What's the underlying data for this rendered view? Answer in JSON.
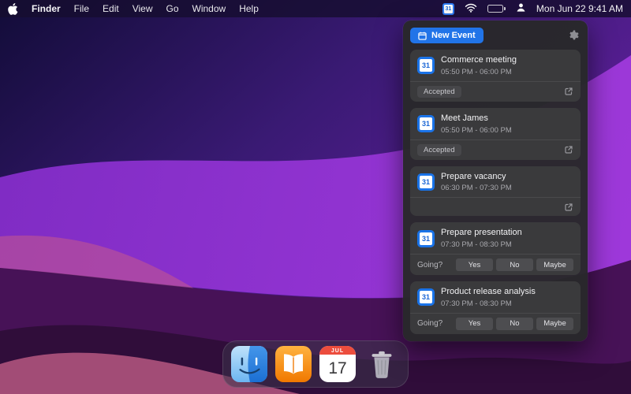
{
  "menubar": {
    "app_name": "Finder",
    "menus": [
      "File",
      "Edit",
      "View",
      "Go",
      "Window",
      "Help"
    ],
    "clock": "Mon Jun 22  9:41 AM",
    "status_icon_number": "31"
  },
  "panel": {
    "new_event": "New Event",
    "icon_number": "31",
    "going_label": "Going?",
    "rsvp": [
      "Yes",
      "No",
      "Maybe"
    ],
    "events": [
      {
        "title": "Commerce meeting",
        "time": "05:50 PM - 06:00 PM",
        "status": "Accepted"
      },
      {
        "title": "Meet James",
        "time": "05:50 PM - 06:00 PM",
        "status": "Accepted"
      },
      {
        "title": "Prepare vacancy",
        "time": "06:30 PM - 07:30 PM",
        "status": ""
      },
      {
        "title": "Prepare presentation",
        "time": "07:30 PM - 08:30 PM",
        "status": "Going?"
      },
      {
        "title": "Product release analysis",
        "time": "07:30 PM - 08:30 PM",
        "status": "Going?"
      }
    ]
  },
  "dock": {
    "calendar_month": "JUL",
    "calendar_day": "17"
  },
  "colors": {
    "accent_blue": "#2174e8",
    "panel_bg": "#28282a",
    "card_bg": "#3a3a3c"
  }
}
